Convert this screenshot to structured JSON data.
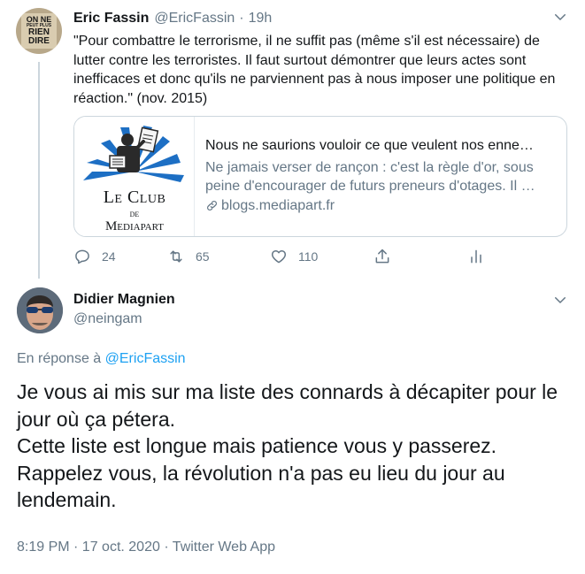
{
  "parent_tweet": {
    "author_name": "Eric Fassin",
    "handle": "@EricFassin",
    "separator": "·",
    "time": "19h",
    "avatar_text": [
      "ON NE",
      "PEUT PLUS",
      "RIEN",
      "DIRE"
    ],
    "text": "\"Pour combattre le terrorisme, il ne suffit pas (même s'il est nécessaire) de lutter contre les terroristes. Il faut surtout démontrer que leurs actes sont inefficaces et donc qu'ils ne parviennent pas à nous imposer une politique en réaction.\" (nov. 2015)",
    "card": {
      "logo_line1": "Le Club",
      "logo_line2": "de",
      "logo_line3": "Mediapart",
      "title": "Nous ne saurions vouloir ce que veulent nos enne…",
      "description": "Ne jamais verser de rançon : c'est la règle d'or, sous peine d'encourager de futurs preneurs d'otages. Il …",
      "domain": "blogs.mediapart.fr"
    },
    "actions": {
      "replies": "24",
      "retweets": "65",
      "likes": "110"
    }
  },
  "reply_tweet": {
    "author_name": "Didier Magnien",
    "handle": "@neingam",
    "in_reply_prefix": "En réponse à",
    "in_reply_mention": "@EricFassin",
    "text_lines": [
      "Je vous ai mis sur ma liste des connards à décapiter pour le jour où ça pétera.",
      "Cette liste est longue mais patience vous y passerez.",
      "Rappelez vous, la révolution n'a pas eu lieu du jour au lendemain."
    ],
    "meta": "8:19 PM · 17 oct. 2020 · Twitter Web App"
  },
  "colors": {
    "text_primary": "#14171a",
    "text_secondary": "#657786",
    "link": "#1da1f2",
    "border": "#ccd6dd",
    "logo_blue": "#1d6fc4"
  },
  "icons": [
    "chevron-down-icon",
    "reply-icon",
    "retweet-icon",
    "like-icon",
    "share-icon",
    "analytics-icon",
    "link-icon"
  ]
}
